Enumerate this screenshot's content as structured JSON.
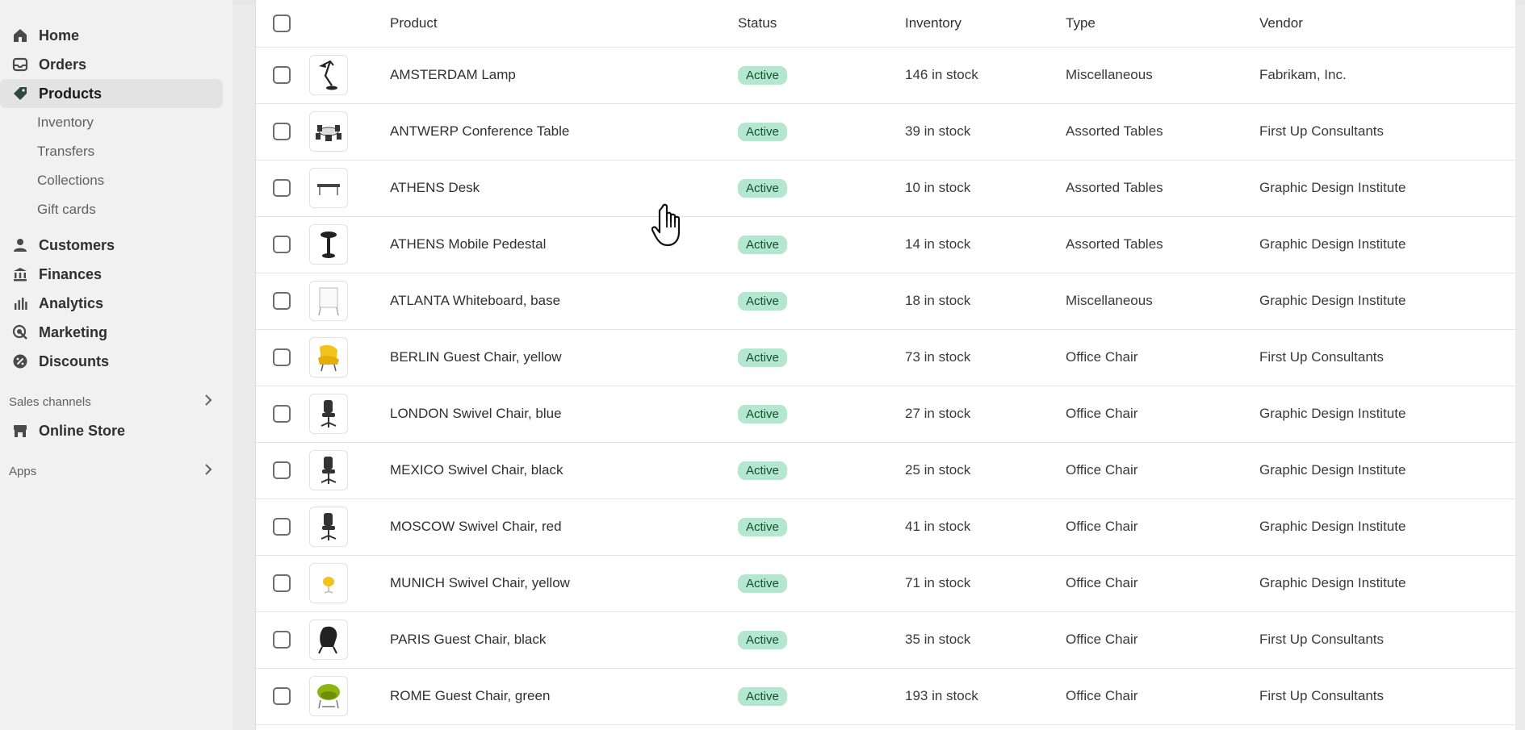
{
  "sidebar": {
    "nav": [
      {
        "label": "Home",
        "icon": "home-icon"
      },
      {
        "label": "Orders",
        "icon": "inbox-icon"
      },
      {
        "label": "Products",
        "icon": "tag-icon"
      }
    ],
    "products_sub": [
      "Inventory",
      "Transfers",
      "Collections",
      "Gift cards"
    ],
    "nav2": [
      {
        "label": "Customers",
        "icon": "person-icon"
      },
      {
        "label": "Finances",
        "icon": "bank-icon"
      },
      {
        "label": "Analytics",
        "icon": "bar-chart-icon"
      },
      {
        "label": "Marketing",
        "icon": "target-icon"
      },
      {
        "label": "Discounts",
        "icon": "discount-icon"
      }
    ],
    "sales_channels_label": "Sales channels",
    "online_store": "Online Store",
    "apps_label": "Apps"
  },
  "table": {
    "headers": {
      "product": "Product",
      "status": "Status",
      "inventory": "Inventory",
      "type": "Type",
      "vendor": "Vendor"
    },
    "rows": [
      {
        "product": "AMSTERDAM Lamp",
        "status": "Active",
        "inventory": "146 in stock",
        "type": "Miscellaneous",
        "vendor": "Fabrikam, Inc.",
        "thumb": "lamp"
      },
      {
        "product": "ANTWERP Conference Table",
        "status": "Active",
        "inventory": "39 in stock",
        "type": "Assorted Tables",
        "vendor": "First Up Consultants",
        "thumb": "table"
      },
      {
        "product": "ATHENS Desk",
        "status": "Active",
        "inventory": "10 in stock",
        "type": "Assorted Tables",
        "vendor": "Graphic Design Institute",
        "thumb": "desk"
      },
      {
        "product": "ATHENS Mobile Pedestal",
        "status": "Active",
        "inventory": "14 in stock",
        "type": "Assorted Tables",
        "vendor": "Graphic Design Institute",
        "thumb": "pedestal"
      },
      {
        "product": "ATLANTA Whiteboard, base",
        "status": "Active",
        "inventory": "18 in stock",
        "type": "Miscellaneous",
        "vendor": "Graphic Design Institute",
        "thumb": "whiteboard"
      },
      {
        "product": "BERLIN Guest Chair, yellow",
        "status": "Active",
        "inventory": "73 in stock",
        "type": "Office Chair",
        "vendor": "First Up Consultants",
        "thumb": "chair-yellow"
      },
      {
        "product": "LONDON Swivel Chair, blue",
        "status": "Active",
        "inventory": "27 in stock",
        "type": "Office Chair",
        "vendor": "Graphic Design Institute",
        "thumb": "swivel"
      },
      {
        "product": "MEXICO Swivel Chair, black",
        "status": "Active",
        "inventory": "25 in stock",
        "type": "Office Chair",
        "vendor": "Graphic Design Institute",
        "thumb": "swivel"
      },
      {
        "product": "MOSCOW Swivel Chair, red",
        "status": "Active",
        "inventory": "41 in stock",
        "type": "Office Chair",
        "vendor": "Graphic Design Institute",
        "thumb": "swivel"
      },
      {
        "product": "MUNICH Swivel Chair, yellow",
        "status": "Active",
        "inventory": "71 in stock",
        "type": "Office Chair",
        "vendor": "Graphic Design Institute",
        "thumb": "munich"
      },
      {
        "product": "PARIS Guest Chair, black",
        "status": "Active",
        "inventory": "35 in stock",
        "type": "Office Chair",
        "vendor": "First Up Consultants",
        "thumb": "paris"
      },
      {
        "product": "ROME Guest Chair, green",
        "status": "Active",
        "inventory": "193 in stock",
        "type": "Office Chair",
        "vendor": "First Up Consultants",
        "thumb": "rome"
      }
    ]
  },
  "colors": {
    "badge_bg": "#b4e6d0",
    "badge_text": "#0c5132",
    "sidebar_bg": "#f1f1f1"
  }
}
